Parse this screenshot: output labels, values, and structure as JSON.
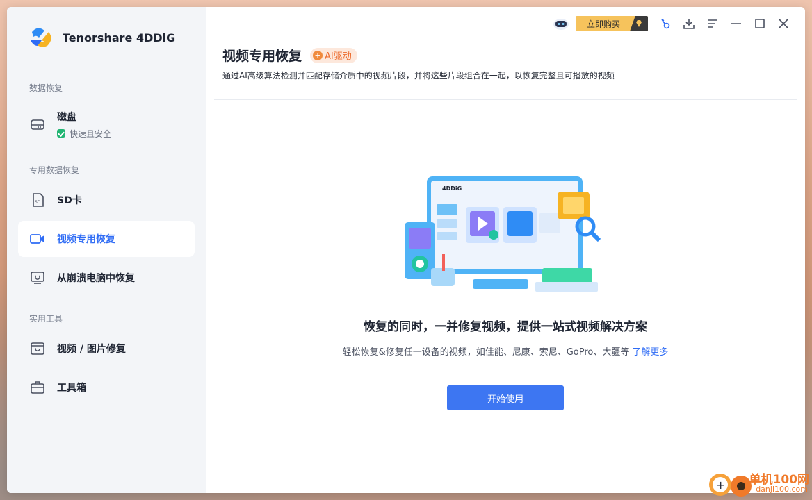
{
  "app": {
    "name": "Tenorshare 4DDiG"
  },
  "sidebar": {
    "sections": {
      "data_recovery": "数据恢复",
      "special_recovery": "专用数据恢复",
      "tools": "实用工具"
    },
    "items": [
      {
        "label": "磁盘",
        "sub": "快速且安全",
        "icon": "hard-drive-icon"
      },
      {
        "label": "SD卡",
        "icon": "sd-card-icon"
      },
      {
        "label": "视频专用恢复",
        "icon": "video-camera-icon",
        "active": true
      },
      {
        "label": "从崩溃电脑中恢复",
        "icon": "crashed-computer-icon"
      },
      {
        "label": "视频 / 图片修复",
        "icon": "media-repair-icon"
      },
      {
        "label": "工具箱",
        "icon": "toolbox-icon"
      }
    ]
  },
  "topbar": {
    "buy_label": "立即购买",
    "icons": [
      "robot-assistant-icon",
      "key-icon",
      "download-icon",
      "menu-icon",
      "minimize-icon",
      "maximize-icon",
      "close-icon"
    ]
  },
  "main": {
    "title": "视频专用恢复",
    "ai_badge": "AI驱动",
    "description": "通过AI高级算法检测并匹配存储介质中的视频片段，并将这些片段组合在一起，以恢复完整且可播放的视频",
    "illustration_brand": "4DDiG",
    "headline": "恢复的同时，一并修复视频，提供一站式视频解决方案",
    "subtext": "轻松恢复&修复任一设备的视频，如佳能、尼康、索尼、GoPro、大疆等",
    "learn_more": "了解更多",
    "start_button": "开始使用"
  },
  "watermark": {
    "text": "单机100网",
    "url": "danji100.com"
  },
  "colors": {
    "accent": "#3d76f2",
    "buy": "#f6c35c",
    "ai_badge": "#ec6b2d",
    "safe_green": "#22b573"
  }
}
